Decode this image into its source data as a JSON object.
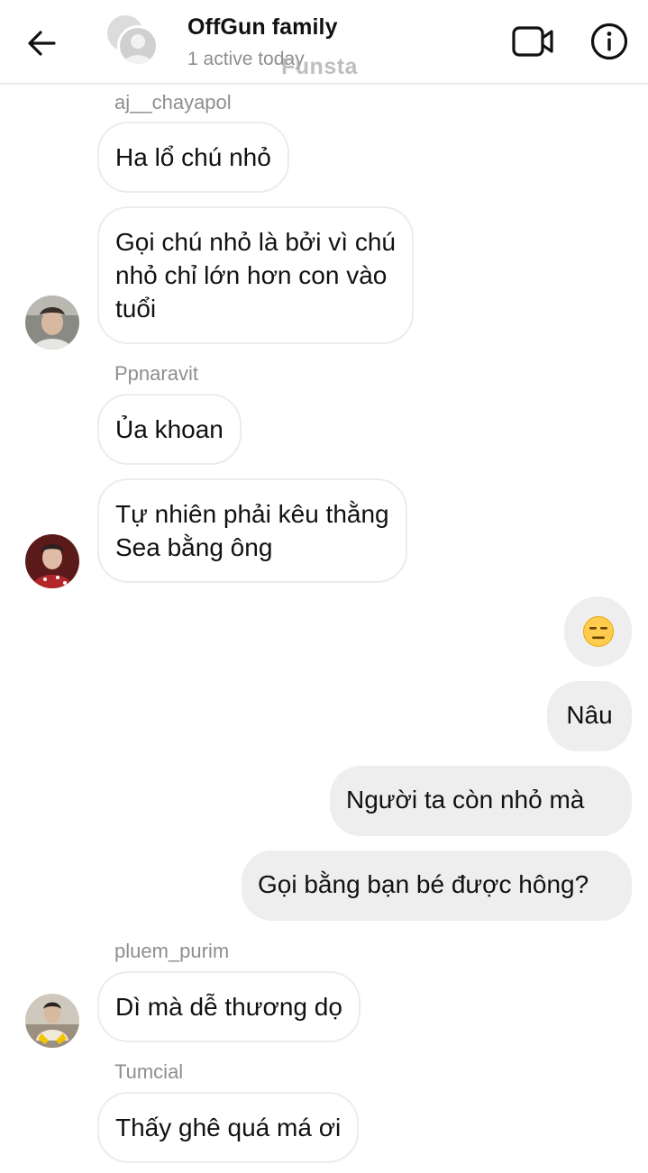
{
  "header": {
    "title": "OffGun family",
    "subtitle": "1 active today",
    "watermark": "Funsta",
    "icons": [
      "back-arrow-icon",
      "group-avatar",
      "video-call-icon",
      "info-icon"
    ]
  },
  "messages": [
    {
      "sender": "aj__chayapol",
      "text": "Ha lổ chú nhỏ"
    },
    {
      "text": "Gọi chú nhỏ là bởi vì chú\nnhỏ chỉ lớn hơn con vào\ntuổi"
    },
    {
      "sender": "Ppnaravit",
      "text": "Ủa khoan"
    },
    {
      "text": "Tự nhiên phải kêu thằng\nSea bằng ông"
    },
    {
      "outgoing_emoji": "expressionless-face-emoji"
    },
    {
      "outgoing": "Nâu"
    },
    {
      "outgoing": "Người ta còn nhỏ mà"
    },
    {
      "outgoing": "Gọi bằng bạn bé được hông?"
    },
    {
      "sender": "pluem_purim",
      "text": "Dì mà dễ thương dọ"
    },
    {
      "sender": "Tumcial",
      "text": "Thấy ghê quá má ơi"
    }
  ],
  "colors": {
    "incoming_bubble_bg": "#ffffff",
    "incoming_bubble_border": "#ececec",
    "outgoing_bubble_bg": "#eeeeee",
    "meta_text": "#8e8e8e"
  }
}
